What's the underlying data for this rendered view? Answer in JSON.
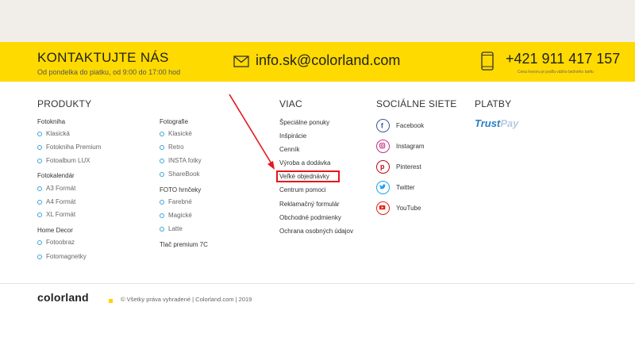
{
  "contact": {
    "title": "KONTAKTUJTE NÁS",
    "hours": "Od pondelka do piatku, od 9:00 do 17:00 hod",
    "email": "info.sk@colorland.com",
    "phone": "+421 911 417 157",
    "phone_note": "Cena hovoru je podľa vášho bežného tarifu",
    "mail_icon": "mail-icon",
    "phone_icon": "phone-icon"
  },
  "produkty": {
    "heading": "PRODUKTY",
    "col1": {
      "fotokniha": {
        "label": "Fotokniha",
        "items": [
          "Klasická",
          "Fotokniha Premium",
          "Fotoalbum LUX"
        ]
      },
      "fotokalendar": {
        "label": "Fotokalendár",
        "items": [
          "A3 Formát",
          "A4 Formát",
          "XL Formát"
        ]
      },
      "homedecor": {
        "label": "Home Decor",
        "items": [
          "Fotoobraz",
          "Fotomagnetky"
        ]
      }
    },
    "col2": {
      "fotografie": {
        "label": "Fotografie",
        "items": [
          "Klasické",
          "Retro",
          "INSTA fotky",
          "ShareBook"
        ]
      },
      "hrnceky": {
        "label": "FOTO hrnčeky",
        "items": [
          "Farebné",
          "Magické",
          "Latte"
        ]
      },
      "tlac": {
        "label": "Tlač premium 7C"
      }
    },
    "bullet_color": "#3ba3db"
  },
  "viac": {
    "heading": "VIAC",
    "items": [
      "Špeciálne ponuky",
      "Inšpirácie",
      "Cenník",
      "Výroba a dodávka",
      "Veľké objednávky",
      "Centrum pomoci",
      "Reklamačný formulár",
      "Obchodné podmienky",
      "Ochrana osobných údajov"
    ],
    "highlight_color": "#e4171c"
  },
  "social": {
    "heading": "SOCIÁLNE SIETE",
    "items": [
      {
        "label": "Facebook",
        "icon": "facebook-icon",
        "color": "#3b5998"
      },
      {
        "label": "Instagram",
        "icon": "instagram-icon",
        "color": "#c13584"
      },
      {
        "label": "Pinterest",
        "icon": "pinterest-icon",
        "color": "#bd081c"
      },
      {
        "label": "Twitter",
        "icon": "twitter-icon",
        "color": "#1da1f2"
      },
      {
        "label": "YouTube",
        "icon": "youtube-icon",
        "color": "#e62117"
      }
    ]
  },
  "platby": {
    "heading": "PLATBY",
    "trustpay_a": "Trust",
    "trustpay_b": "Pay"
  },
  "footer": {
    "logo_text": "colorland",
    "copyright": "© Všetky práva vyhradené | Colorland.com | 2019"
  },
  "colors": {
    "accent_yellow": "#ffda00",
    "top_strip": "#f1eeea",
    "annotation_red": "#e4171c"
  }
}
